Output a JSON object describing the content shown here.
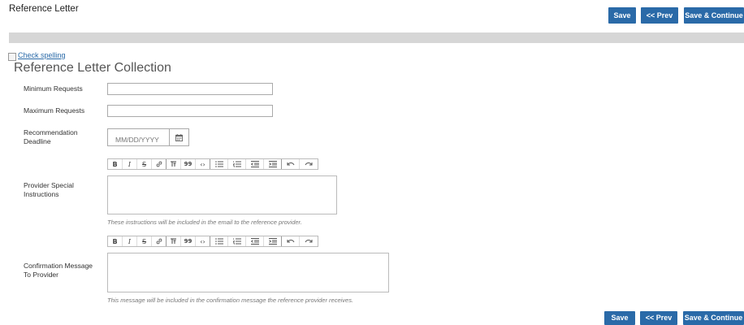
{
  "header": {
    "title": "Reference Letter",
    "buttons": {
      "save": "Save",
      "prev": "<< Prev",
      "save_continue": "Save & Continue"
    }
  },
  "spellcheck": {
    "label": "Check spelling"
  },
  "section": {
    "title": "Reference Letter Collection"
  },
  "form": {
    "minimum_requests": {
      "label": "Minimum Requests",
      "value": ""
    },
    "maximum_requests": {
      "label": "Maximum Requests",
      "value": ""
    },
    "deadline": {
      "label_line1": "Recommendation",
      "label_line2": "Deadline",
      "placeholder": "MM/DD/YYYY"
    },
    "provider_instructions": {
      "label_line1": "Provider Special",
      "label_line2": "Instructions",
      "hint": "These instructions will be included in the email to the reference provider."
    },
    "confirmation_message": {
      "label_line1": "Confirmation Message",
      "label_line2": "To Provider",
      "hint": "This message will be included in the confirmation message the reference provider receives."
    }
  },
  "toolbar": {
    "bold": "B",
    "italic": "I",
    "strike": "S",
    "link": "🔗",
    "text_size": "T͟T",
    "quote": "99",
    "code": "‹›",
    "bullets": "☰",
    "numbers": "☰",
    "outdent": "⇤",
    "indent": "⇥",
    "undo": "↶",
    "redo": "↷"
  },
  "footer": {
    "buttons": {
      "save": "Save",
      "prev": "<< Prev",
      "save_continue": "Save & Continue"
    }
  },
  "colors": {
    "button": "#2a6aa8",
    "bar": "#d6d6d6"
  }
}
